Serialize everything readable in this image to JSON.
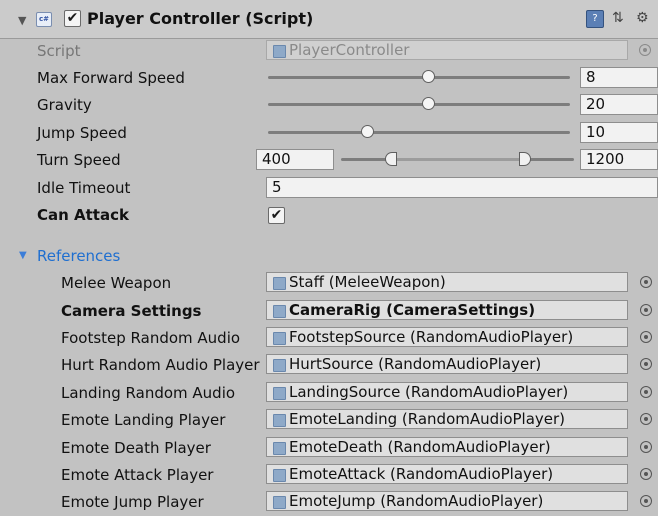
{
  "header": {
    "fold_glyph": "▼",
    "script_icon_text": "c#",
    "enabled_check": "✔",
    "title": "Player Controller (Script)",
    "help_glyph": "?",
    "preset_glyph": "⇅",
    "gear_glyph": "⚙"
  },
  "script_row": {
    "label": "Script",
    "value": "PlayerController"
  },
  "props": {
    "max_forward_speed": {
      "label": "Max Forward Speed",
      "value": "8",
      "slider_fraction": 0.53
    },
    "gravity": {
      "label": "Gravity",
      "value": "20",
      "slider_fraction": 0.53
    },
    "jump_speed": {
      "label": "Jump Speed",
      "value": "10",
      "slider_fraction": 0.33
    },
    "turn_speed": {
      "label": "Turn Speed",
      "min_value": "400",
      "max_value": "1200"
    },
    "idle_timeout": {
      "label": "Idle Timeout",
      "value": "5"
    },
    "can_attack": {
      "label": "Can Attack",
      "check": "✔"
    }
  },
  "references": {
    "fold_glyph": "▼",
    "label": "References",
    "items": [
      {
        "label": "Melee Weapon",
        "value": "Staff (MeleeWeapon)"
      },
      {
        "label": "Camera Settings",
        "value": "CameraRig (CameraSettings)"
      },
      {
        "label": "Footstep Random Audio",
        "value": "FootstepSource (RandomAudioPlayer)"
      },
      {
        "label": "Hurt Random Audio Player",
        "value": "HurtSource (RandomAudioPlayer)"
      },
      {
        "label": "Landing Random Audio",
        "value": "LandingSource (RandomAudioPlayer)"
      },
      {
        "label": "Emote Landing Player",
        "value": "EmoteLanding (RandomAudioPlayer)"
      },
      {
        "label": "Emote Death Player",
        "value": "EmoteDeath (RandomAudioPlayer)"
      },
      {
        "label": "Emote Attack Player",
        "value": "EmoteAttack (RandomAudioPlayer)"
      },
      {
        "label": "Emote Jump Player",
        "value": "EmoteJump (RandomAudioPlayer)"
      }
    ]
  },
  "colors": {
    "background": "#c2c2c2",
    "section_blue": "#1f6fd0"
  }
}
